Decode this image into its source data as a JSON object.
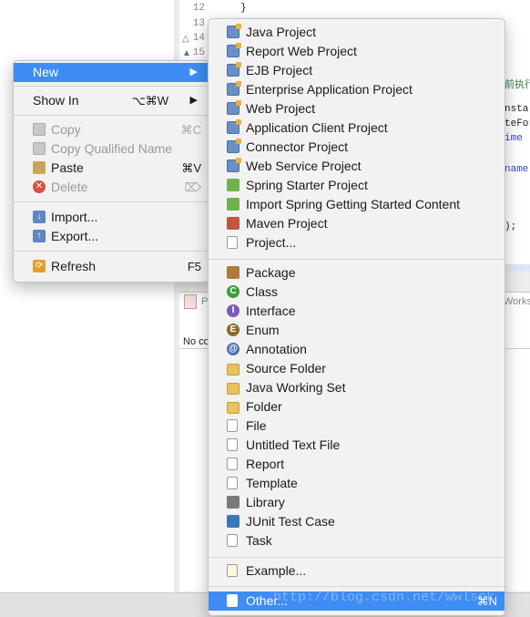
{
  "editor": {
    "lines": [
      {
        "num": "12",
        "text": "}"
      },
      {
        "num": "13",
        "text": ""
      },
      {
        "num": "14",
        "text": ""
      },
      {
        "num": "15",
        "text": ""
      }
    ],
    "fragments": {
      "f1": "前执行",
      "f2": "nsta",
      "f3": "teFor",
      "f4": "ime",
      "f5": "name",
      "f6": ");"
    }
  },
  "panel": {
    "tab_label": "P",
    "works_label": "Works",
    "no_content": "No co"
  },
  "context_menu": {
    "new": {
      "label": "New"
    },
    "show_in": {
      "label": "Show In",
      "shortcut": "⌥⌘W"
    },
    "copy": {
      "label": "Copy",
      "shortcut": "⌘C"
    },
    "copy_qualified": {
      "label": "Copy Qualified Name"
    },
    "paste": {
      "label": "Paste",
      "shortcut": "⌘V"
    },
    "delete": {
      "label": "Delete",
      "shortcut": "⌦"
    },
    "import": {
      "label": "Import..."
    },
    "export": {
      "label": "Export..."
    },
    "refresh": {
      "label": "Refresh",
      "shortcut": "F5"
    }
  },
  "submenu": {
    "group1": [
      {
        "label": "Java Project",
        "icon": "java-project-icon"
      },
      {
        "label": "Report Web Project",
        "icon": "report-web-project-icon"
      },
      {
        "label": "EJB Project",
        "icon": "ejb-project-icon"
      },
      {
        "label": "Enterprise Application Project",
        "icon": "enterprise-application-project-icon"
      },
      {
        "label": "Web Project",
        "icon": "web-project-icon"
      },
      {
        "label": "Application Client Project",
        "icon": "application-client-project-icon"
      },
      {
        "label": "Connector Project",
        "icon": "connector-project-icon"
      },
      {
        "label": "Web Service Project",
        "icon": "web-service-project-icon"
      },
      {
        "label": "Spring Starter Project",
        "icon": "spring-starter-project-icon"
      },
      {
        "label": "Import Spring Getting Started Content",
        "icon": "spring-import-icon"
      },
      {
        "label": "Maven Project",
        "icon": "maven-project-icon"
      },
      {
        "label": "Project...",
        "icon": "project-icon"
      }
    ],
    "group2": [
      {
        "label": "Package",
        "icon": "package-icon"
      },
      {
        "label": "Class",
        "icon": "class-icon"
      },
      {
        "label": "Interface",
        "icon": "interface-icon"
      },
      {
        "label": "Enum",
        "icon": "enum-icon"
      },
      {
        "label": "Annotation",
        "icon": "annotation-icon"
      },
      {
        "label": "Source Folder",
        "icon": "source-folder-icon"
      },
      {
        "label": "Java Working Set",
        "icon": "java-working-set-icon"
      },
      {
        "label": "Folder",
        "icon": "folder-icon"
      },
      {
        "label": "File",
        "icon": "file-icon"
      },
      {
        "label": "Untitled Text File",
        "icon": "untitled-text-file-icon"
      },
      {
        "label": "Report",
        "icon": "report-icon"
      },
      {
        "label": "Template",
        "icon": "template-icon"
      },
      {
        "label": "Library",
        "icon": "library-icon"
      },
      {
        "label": "JUnit Test Case",
        "icon": "junit-test-case-icon"
      },
      {
        "label": "Task",
        "icon": "task-icon"
      }
    ],
    "example": {
      "label": "Example...",
      "icon": "example-icon"
    },
    "other": {
      "label": "Other...",
      "shortcut": "⌘N",
      "icon": "other-icon"
    }
  },
  "watermark": "http://blog.csdn.net/wwlsck",
  "colors": {
    "highlight": "#3d8df5",
    "menu_bg": "#f2f2f2"
  }
}
